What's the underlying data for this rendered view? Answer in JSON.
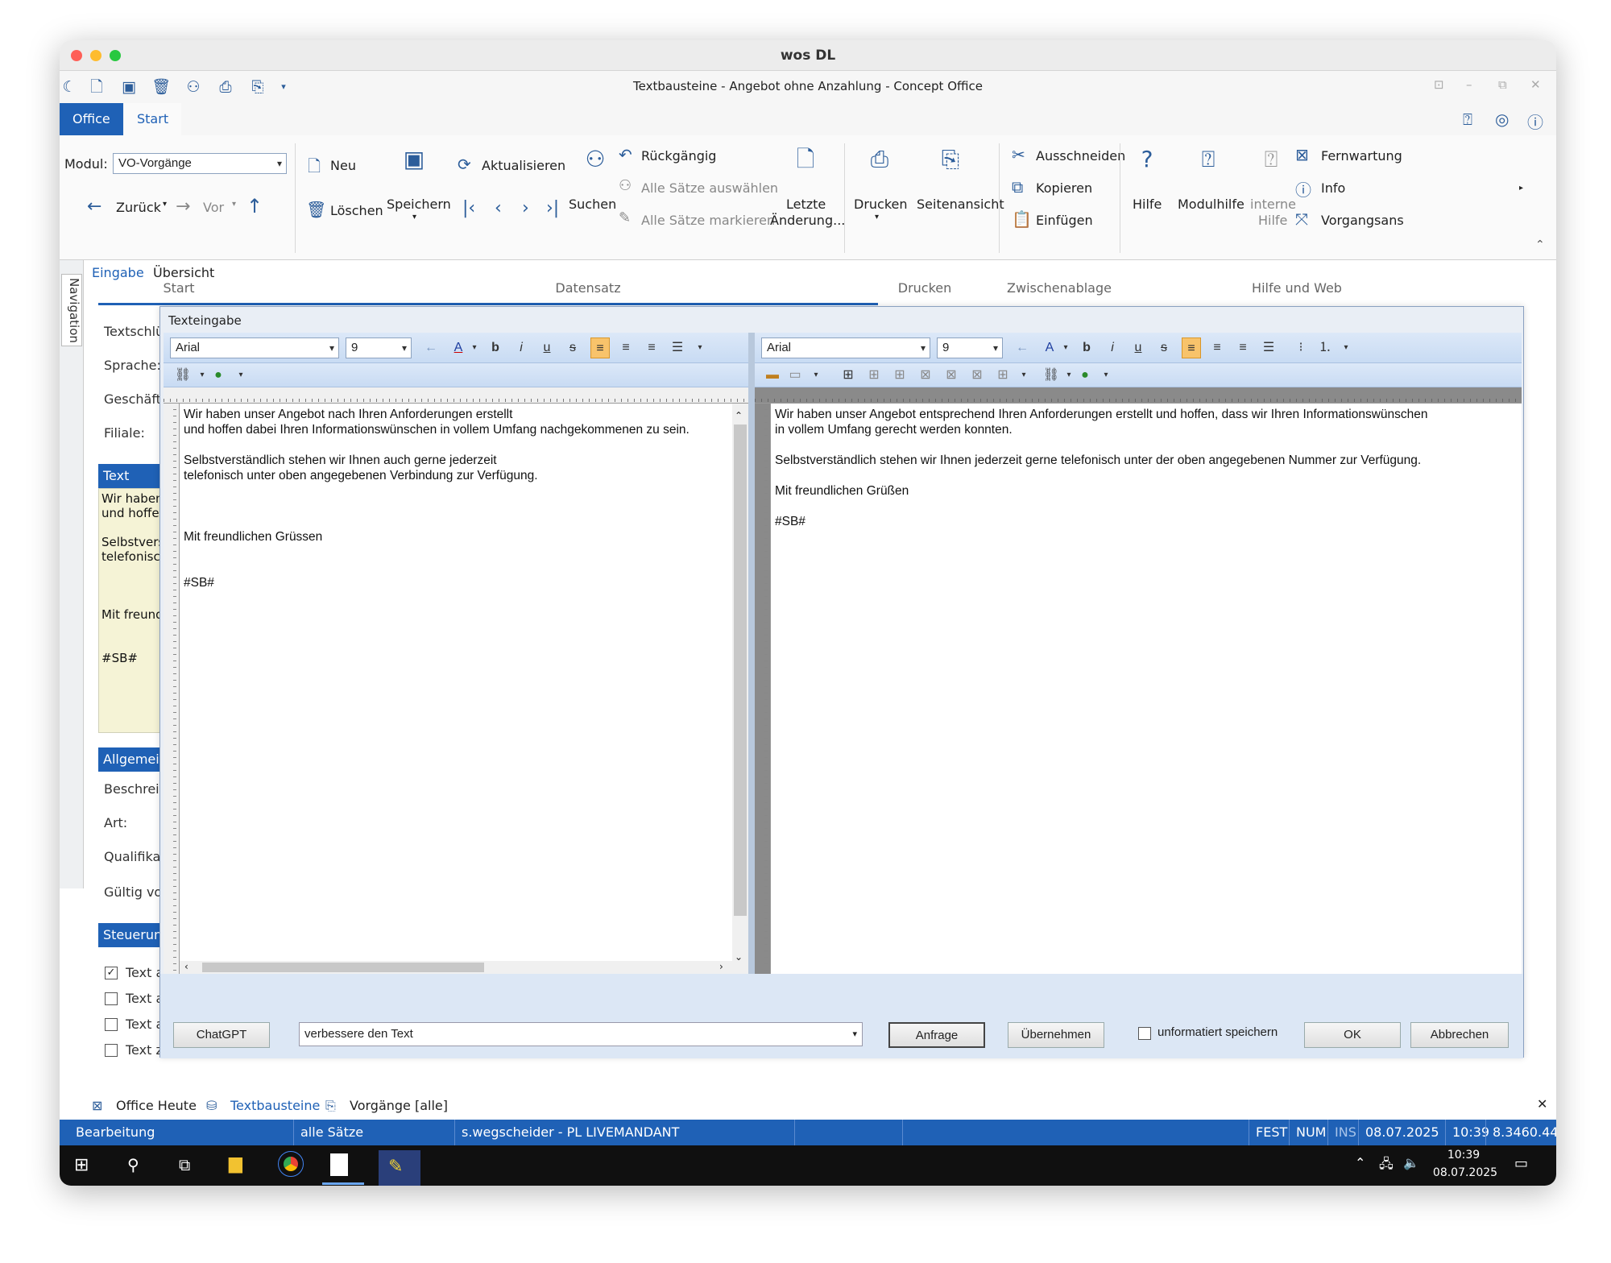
{
  "window": {
    "title": "wos DL",
    "doc_title": "Textbausteine - Angebot ohne Anzahlung - Concept Office"
  },
  "tabs": {
    "office": "Office",
    "start": "Start"
  },
  "ribbon": {
    "modul_label": "Modul:",
    "modul_value": "VO-Vorgänge",
    "zurueck": "Zurück",
    "vor": "Vor",
    "neu": "Neu",
    "loeschen": "Löschen",
    "speichern": "Speichern",
    "aktualisieren": "Aktualisieren",
    "suchen": "Suchen",
    "rueckgaengig": "Rückgängig",
    "alle_auswaehlen": "Alle Sätze auswählen",
    "alle_markieren": "Alle Sätze markieren",
    "letzte1": "Letzte",
    "letzte2": "Änderung...",
    "drucken": "Drucken",
    "seitenansicht": "Seitenansicht",
    "ausschneiden": "Ausschneiden",
    "kopieren": "Kopieren",
    "einfuegen": "Einfügen",
    "hilfe": "Hilfe",
    "modulhilfe": "Modulhilfe",
    "interne1": "interne",
    "interne2": "Hilfe",
    "fernwartung": "Fernwartung",
    "info": "Info",
    "vorgangsans": "Vorgangsans",
    "groups": {
      "start": "Start",
      "datensatz": "Datensatz",
      "drucken": "Drucken",
      "zwischenablage": "Zwischenablage",
      "hilfe": "Hilfe und Web"
    }
  },
  "nav_label": "Navigation",
  "subtabs": {
    "eingabe": "Eingabe",
    "uebersicht": "Übersicht"
  },
  "form": {
    "textschl": "Textschlü",
    "sprache": "Sprache:",
    "geschaeft": "Geschäft",
    "filiale": "Filiale:",
    "text_header": "Text",
    "text_lines": [
      "Wir haben",
      "und hoffen",
      "",
      "Selbstvers",
      "telefonisch",
      "",
      "",
      "",
      "Mit freundl",
      "",
      "",
      "#SB#"
    ],
    "allgemein": "Allgemein",
    "beschreib": "Beschreib",
    "art": "Art:",
    "qualifika": "Qualifika",
    "gueltig": "Gültig vo",
    "steuerung": "Steuerung",
    "chk1": "Text a",
    "chk2": "Text a",
    "chk3": "Text a",
    "chk4": "Text zur Avisierung"
  },
  "dialog": {
    "title": "Texteingabe",
    "font": "Arial",
    "size": "9",
    "left_text": [
      "Wir haben unser Angebot nach Ihren Anforderungen erstellt",
      "und hoffen dabei Ihren Informationswünschen in vollem Umfang nachgekommenen zu sein.",
      "",
      "Selbstverständlich stehen wir Ihnen auch gerne jederzeit",
      "telefonisch unter oben angegebenen Verbindung zur Verfügung.",
      "",
      "",
      "",
      "Mit freundlichen Grüssen",
      "",
      "",
      "#SB#"
    ],
    "right_text": [
      "Wir haben unser Angebot entsprechend Ihren Anforderungen erstellt und hoffen, dass wir Ihren Informationswünschen",
      "in vollem Umfang gerecht werden konnten.",
      "",
      "Selbstverständlich stehen wir Ihnen jederzeit gerne telefonisch unter der oben angegebenen Nummer zur Verfügung.",
      "",
      "Mit freundlichen Grüßen",
      "",
      "#SB#"
    ],
    "chatgpt": "ChatGPT",
    "prompt": "verbessere den Text",
    "anfrage": "Anfrage",
    "uebernehmen": "Übernehmen",
    "unformatiert": "unformatiert speichern",
    "ok": "OK",
    "abbrechen": "Abbrechen"
  },
  "bottom_tabs": {
    "office_heute": "Office Heute",
    "textbausteine": "Textbausteine",
    "vorgaenge": "Vorgänge [alle]"
  },
  "status": {
    "bearbeitung": "Bearbeitung",
    "saetze": "alle Sätze",
    "user": "s.wegscheider - PL LIVEMANDANT",
    "fest": "FEST",
    "num": "NUM",
    "ins": "INS",
    "date": "08.07.2025",
    "time": "10:39",
    "version": "8.3460.44"
  },
  "taskbar": {
    "time": "10:39",
    "date": "08.07.2025"
  },
  "colors": {
    "accent": "#1f61b6"
  }
}
